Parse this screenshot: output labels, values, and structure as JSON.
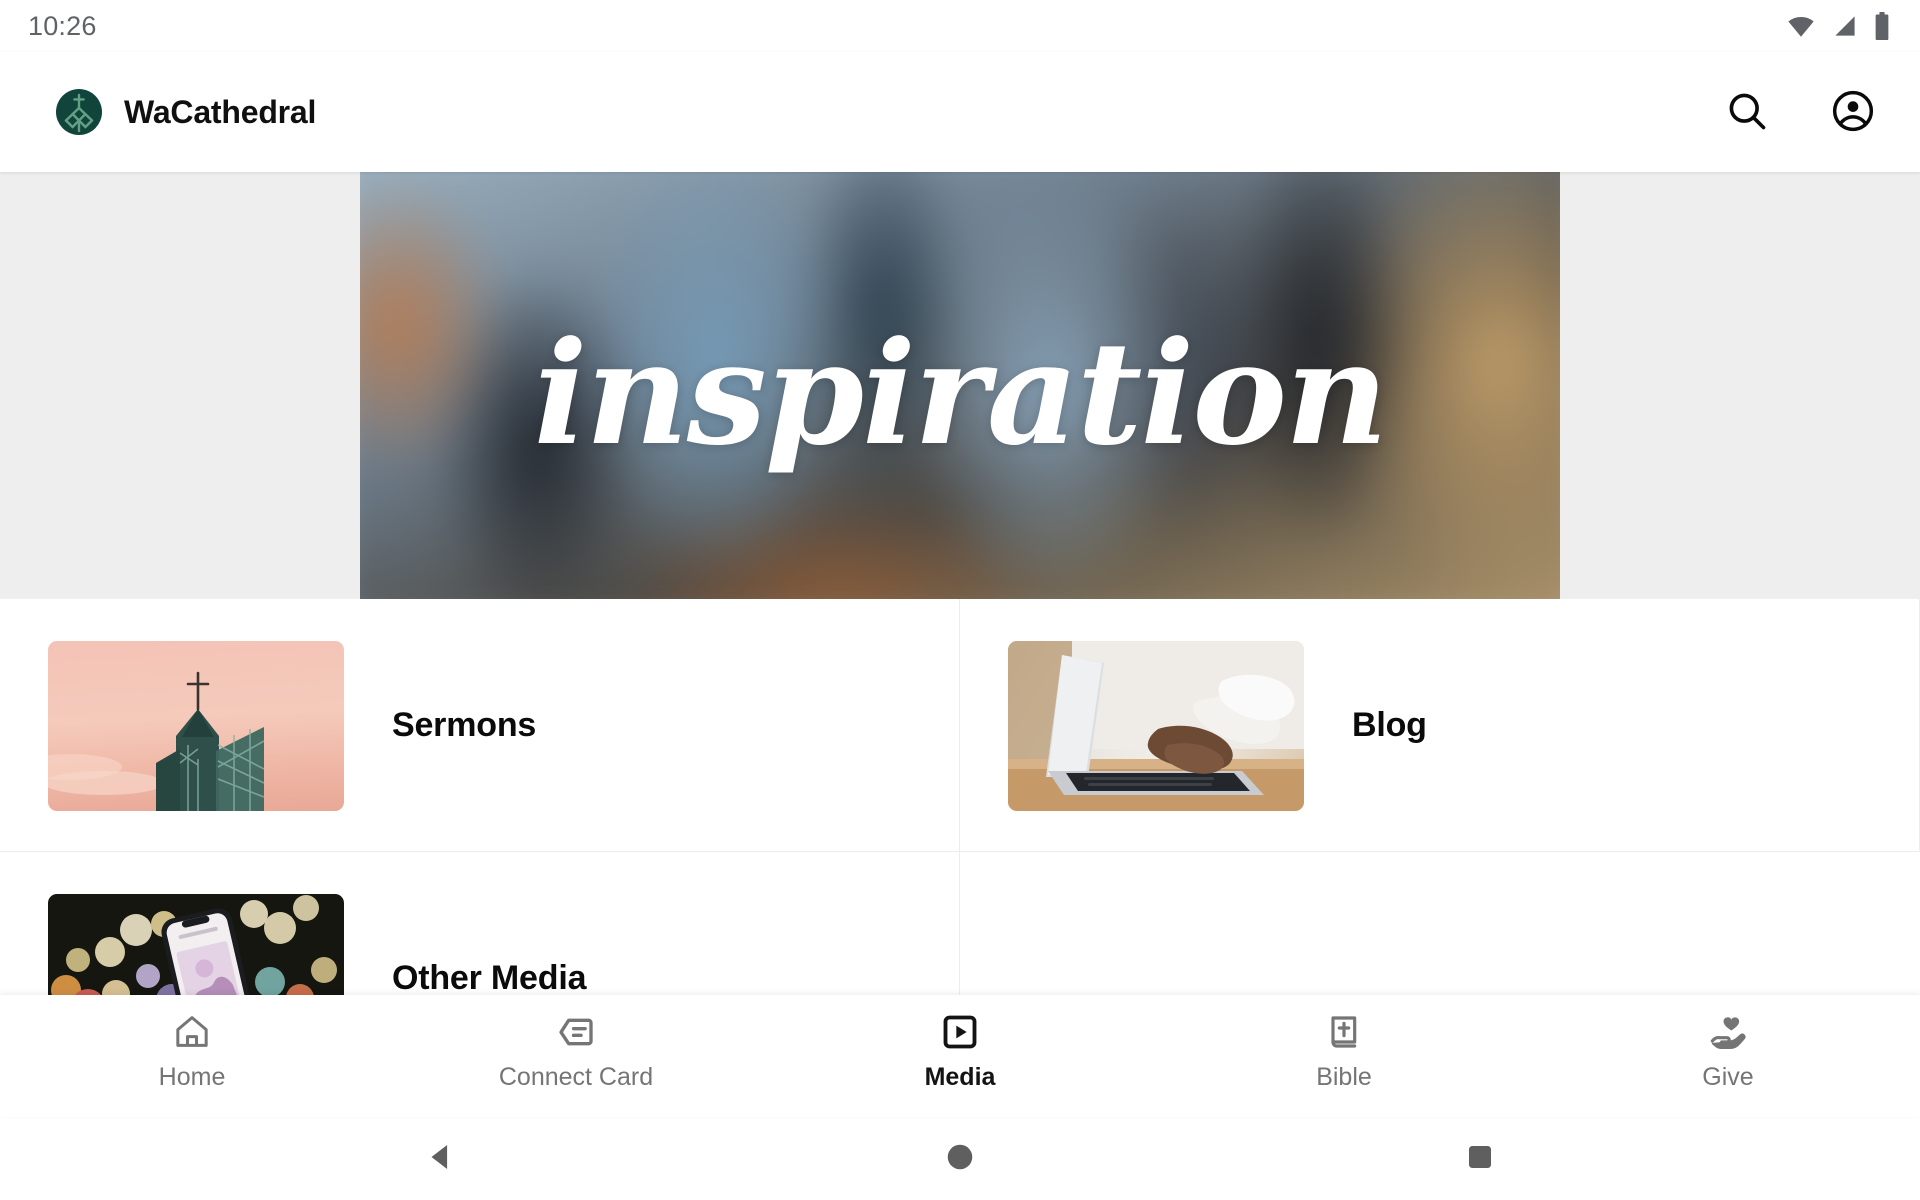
{
  "status_bar": {
    "time": "10:26",
    "icons": [
      "wifi-icon",
      "cell-signal-icon",
      "battery-icon"
    ],
    "icon_color": "#5f6368"
  },
  "app_bar": {
    "logo_name": "wacathedral-logo",
    "logo_bg_color": "#11453c",
    "logo_mark_color": "#5f9e80",
    "title": "WaCathedral",
    "actions": [
      {
        "name": "search-icon",
        "label": "Search"
      },
      {
        "name": "account-circle-icon",
        "label": "Account"
      }
    ]
  },
  "hero": {
    "name": "inspiration-banner",
    "word": "inspiration",
    "text_color": "#ffffff",
    "backdrop_color": "#eeeeee"
  },
  "media_tiles": [
    {
      "label": "Sermons",
      "thumb": "church-steeple-sunset-photo"
    },
    {
      "label": "Blog",
      "thumb": "hands-typing-laptop-photo"
    },
    {
      "label": "Other Media",
      "thumb": "phone-bokeh-lights-photo"
    }
  ],
  "bottom_nav": {
    "active_index": 2,
    "active_color": "#141414",
    "inactive_color": "#757575",
    "items": [
      {
        "label": "Home",
        "icon": "home-icon"
      },
      {
        "label": "Connect Card",
        "icon": "connect-card-icon"
      },
      {
        "label": "Media",
        "icon": "media-play-icon"
      },
      {
        "label": "Bible",
        "icon": "bible-book-icon"
      },
      {
        "label": "Give",
        "icon": "hand-heart-icon"
      }
    ]
  },
  "system_nav": {
    "color": "#5f5f5f",
    "buttons": [
      {
        "name": "back-button",
        "icon": "triangle-back-icon"
      },
      {
        "name": "home-button",
        "icon": "circle-home-icon"
      },
      {
        "name": "recents-button",
        "icon": "square-recents-icon"
      }
    ]
  }
}
